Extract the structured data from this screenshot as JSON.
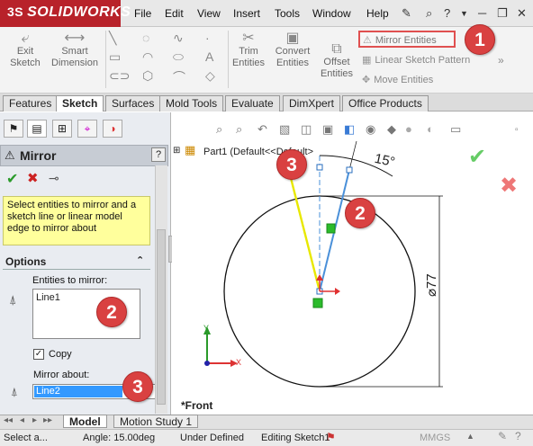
{
  "titlebar": {
    "logo_prefix": "3S",
    "logo": "SOLIDWORKS",
    "menus": [
      "File",
      "Edit",
      "View",
      "Insert",
      "Tools",
      "Window",
      "Help"
    ],
    "icons": [
      "pin-icon",
      "search-icon",
      "help-icon",
      "minimize-icon",
      "restore-icon",
      "close-icon"
    ]
  },
  "ribbon": {
    "exit_sketch": "Exit\nSketch",
    "smart_dimension": "Smart\nDimension",
    "trim_entities": "Trim\nEntities",
    "convert_entities": "Convert\nEntities",
    "offset_entities": "Offset\nEntities",
    "mirror_entities": "Mirror Entities",
    "linear_sketch_pattern": "Linear Sketch Pattern",
    "move_entities": "Move Entities"
  },
  "tabs": [
    "Features",
    "Sketch",
    "Surfaces",
    "Mold Tools",
    "Evaluate",
    "DimXpert",
    "Office Products"
  ],
  "active_tab": "Sketch",
  "pm": {
    "title": "Mirror",
    "help": "?",
    "message": "Select entities to mirror and a sketch line or linear model edge to mirror about",
    "options_header": "Options",
    "entities_label": "Entities to mirror:",
    "entities_value": "Line1",
    "copy_label": "Copy",
    "copy_checked": "✓",
    "mirror_about_label": "Mirror about:",
    "mirror_about_value": "Line2"
  },
  "graphics": {
    "tree_item": "Part1  (Default<<Default>",
    "angle_dim": "15°",
    "diameter_dim": "⌀77",
    "view_label": "*Front",
    "axis_y": "Y",
    "axis_x": "X"
  },
  "badges": [
    "1",
    "2",
    "2",
    "3",
    "3"
  ],
  "bottom_tabs": [
    "Model",
    "Motion Study 1"
  ],
  "status": {
    "select": "Select a...",
    "angle": "Angle: 15.00deg",
    "defined": "Under Defined",
    "editing": "Editing Sketch1",
    "units": "MMGS"
  },
  "colors": {
    "logo_bg": "#b8222a",
    "highlight": "#e05050",
    "badge": "#d94141",
    "message_bg": "#ffff9c",
    "selection": "#3399ff",
    "yellow_line": "#e8e800",
    "blue_line": "#4a90d9"
  }
}
